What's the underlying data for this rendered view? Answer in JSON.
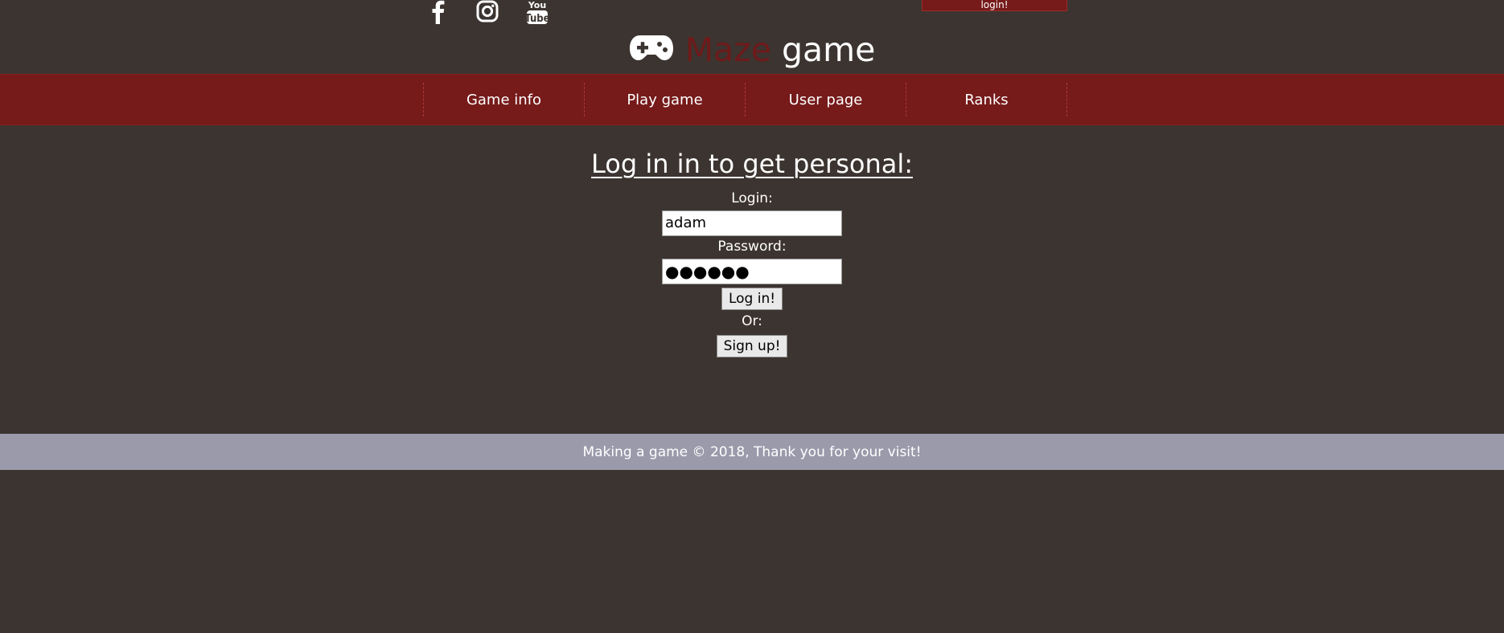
{
  "header": {
    "login_link": "login!",
    "social": [
      "facebook-icon",
      "instagram-icon",
      "youtube-icon"
    ],
    "youtube_text_top": "You",
    "youtube_text_bottom": "Tube",
    "logo_word1": "Maze",
    "logo_word2": "game"
  },
  "nav": {
    "items": [
      "Game info",
      "Play game",
      "User page",
      "Ranks"
    ]
  },
  "form": {
    "title": "Log in in to get personal:",
    "login_label": "Login:",
    "login_value": "adam",
    "password_label": "Password:",
    "password_value": "●●●●●●",
    "login_button": "Log in!",
    "or_text": "Or:",
    "signup_button": "Sign up!"
  },
  "footer": {
    "text": "Making a game © 2018, Thank you for your visit!"
  },
  "colors": {
    "background": "#3c3430",
    "nav": "#761a1a",
    "maze_word": "#6e1a1a",
    "footer": "#9b9aab"
  }
}
